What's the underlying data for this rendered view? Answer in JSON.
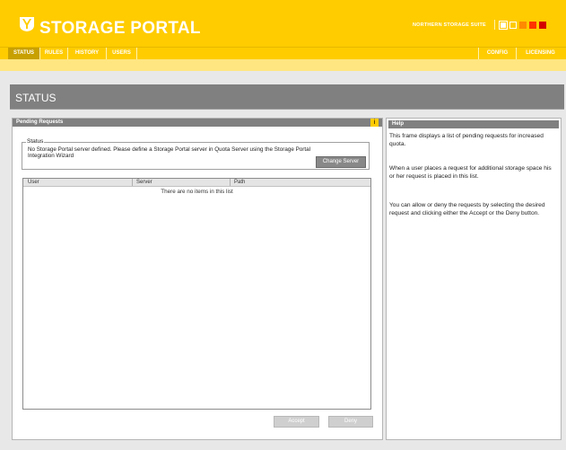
{
  "header": {
    "title": "STORAGE PORTAL",
    "suite": "NORTHERN STORAGE SUITE",
    "logo_icon": "shield-logo-icon",
    "swatches": [
      "#ffffff",
      "#ffcc00",
      "#ff8a00",
      "#ff3300",
      "#d40000"
    ]
  },
  "nav": {
    "tabs": [
      {
        "label": "STATUS",
        "active": true
      },
      {
        "label": "RULES"
      },
      {
        "label": "HISTORY"
      },
      {
        "label": "USERS"
      }
    ],
    "right_tabs": [
      {
        "label": "CONFIG"
      },
      {
        "label": "LICENSING"
      }
    ]
  },
  "page": {
    "title": "STATUS"
  },
  "pending": {
    "header": "Pending Requests",
    "info_icon": "i",
    "status_legend": "Status",
    "status_message": "No Storage Portal server defined. Please define a Storage Portal server in Quota Server using the Storage Portal Integration Wizard",
    "change_server_label": "Change Server",
    "columns": [
      "User",
      "Server",
      "Path"
    ],
    "empty_text": "There are no items in this list",
    "accept_label": "Accept",
    "deny_label": "Deny"
  },
  "help": {
    "header": "Help",
    "paragraphs": [
      "This frame displays a list of pending requests for increased quota.",
      "When a user places a request for additional storage space his or her request is placed in this list.",
      "You can allow or deny the requests by selecting the desired request and clicking either the Accept or the Deny button."
    ]
  },
  "colors": {
    "accent": "#ffcc00",
    "banner": "#808080"
  }
}
